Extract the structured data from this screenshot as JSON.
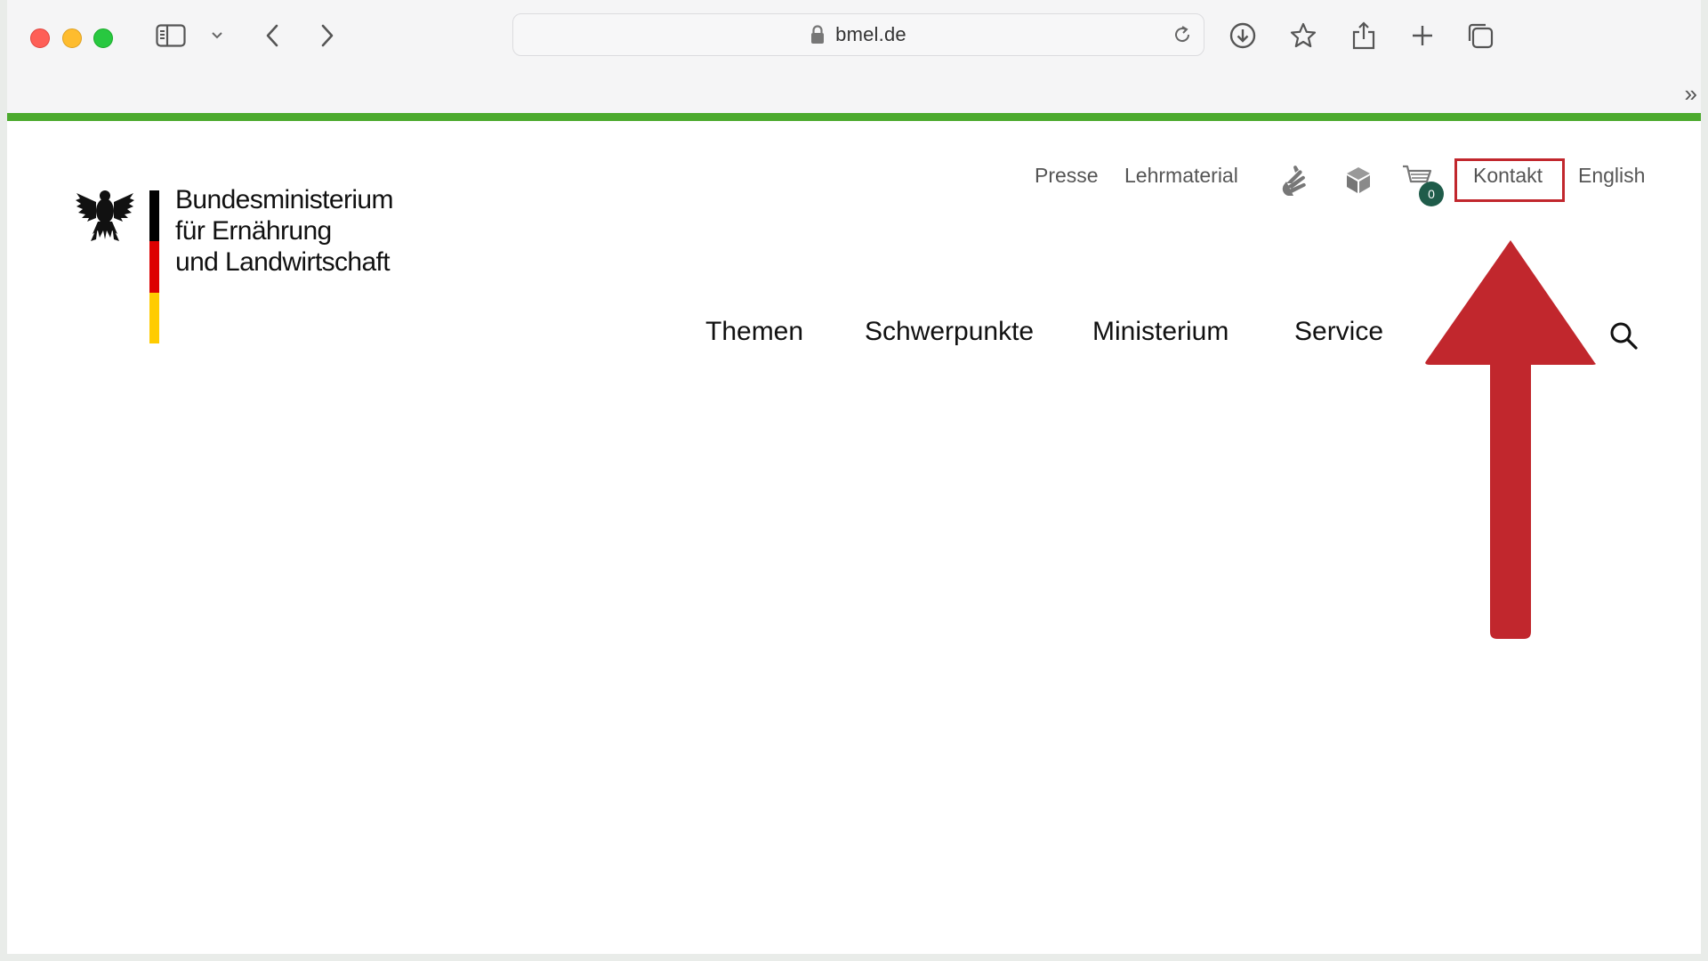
{
  "browser": {
    "url": "bmel.de",
    "overflow_symbol": "»"
  },
  "site": {
    "logo_lines": [
      "Bundesministerium",
      "für Ernährung",
      "und Landwirtschaft"
    ],
    "flag_colors": [
      "#000000",
      "#dd0000",
      "#ffcc00"
    ]
  },
  "meta_nav": {
    "presse": "Presse",
    "lehrmaterial": "Lehrmaterial",
    "cart_count": "0",
    "kontakt": "Kontakt",
    "english": "English"
  },
  "main_nav": {
    "themen": "Themen",
    "schwerpunkte": "Schwerpunkte",
    "ministerium": "Ministerium",
    "service": "Service"
  },
  "annotation": {
    "highlight_color": "#c1272d",
    "arrow_color": "#c1272d"
  },
  "icons": {
    "sidebar": "sidebar-icon",
    "back": "chevron-left-icon",
    "forward": "chevron-right-icon",
    "download": "download-icon",
    "bookmark": "star-icon",
    "share": "share-icon",
    "new_tab": "plus-icon",
    "tabs": "tabs-icon",
    "sign_language": "sign-language-icon",
    "easy_language": "cube-icon",
    "cart": "cart-icon",
    "search": "search-icon"
  }
}
